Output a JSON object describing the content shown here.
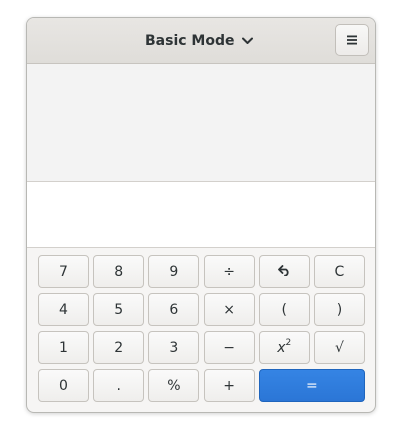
{
  "header": {
    "mode_label": "Basic Mode"
  },
  "history": {},
  "entry": {
    "value": ""
  },
  "keypad": {
    "rows": [
      [
        "7",
        "8",
        "9",
        "÷",
        "undo",
        "C"
      ],
      [
        "4",
        "5",
        "6",
        "×",
        "(",
        ")"
      ],
      [
        "1",
        "2",
        "3",
        "−",
        "x²",
        "√"
      ],
      [
        "0",
        ".",
        "%",
        "+",
        "="
      ]
    ],
    "k7": "7",
    "k8": "8",
    "k9": "9",
    "divide": "÷",
    "clear": "C",
    "k4": "4",
    "k5": "5",
    "k6": "6",
    "multiply": "×",
    "lparen": "(",
    "rparen": ")",
    "k1": "1",
    "k2": "2",
    "k3": "3",
    "minus": "−",
    "square_base": "x",
    "square_exp": "2",
    "sqrt": "√",
    "k0": "0",
    "point": ".",
    "percent": "%",
    "plus": "+",
    "equals": "="
  },
  "colors": {
    "accent": "#3584e4",
    "text": "#2e3436"
  },
  "icons": {
    "mode_chevron": "chevron-down-icon",
    "menu": "hamburger-menu-icon",
    "undo": "undo-icon"
  }
}
